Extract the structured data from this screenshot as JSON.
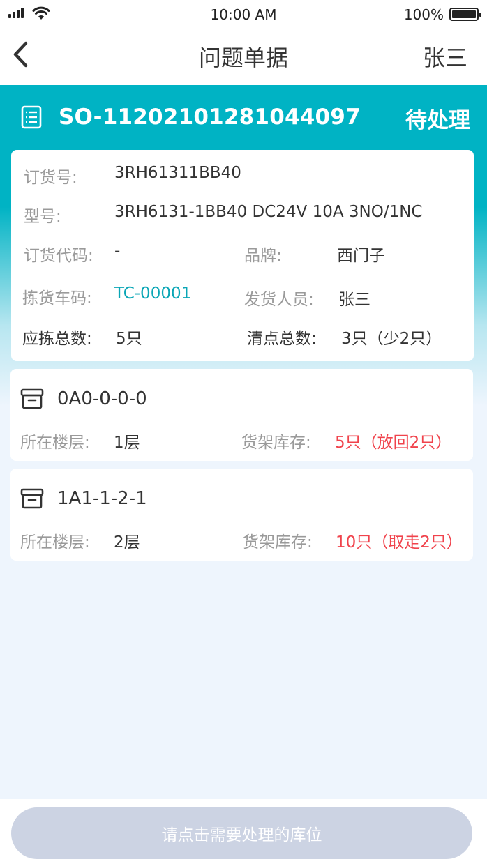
{
  "status_bar": {
    "time": "10:00 AM",
    "battery": "100%"
  },
  "nav": {
    "title": "问题单据",
    "user": "张三",
    "back_icon": "chevron-left-icon"
  },
  "order": {
    "number": "SO-11202101281044097",
    "status": "待处理",
    "icon": "document-list-icon"
  },
  "details": {
    "order_no_label": "订货号:",
    "order_no": "3RH61311BB40",
    "model_label": "型号:",
    "model": "3RH6131-1BB40 DC24V 10A 3NO/1NC",
    "order_code_label": "订货代码:",
    "order_code": "-",
    "brand_label": "品牌:",
    "brand": "西门子",
    "pick_cart_label": "拣货车码:",
    "pick_cart": "TC-00001",
    "shipper_label": "发货人员:",
    "shipper": "张三",
    "pick_total_label": "应拣总数:",
    "pick_total": "5只",
    "count_total_label": "清点总数:",
    "count_total": "3只（少2只）"
  },
  "locations": [
    {
      "code": "0A0-0-0-0",
      "floor_label": "所在楼层:",
      "floor": "1层",
      "stock_label": "货架库存:",
      "stock": "5只（放回2只）"
    },
    {
      "code": "1A1-1-2-1",
      "floor_label": "所在楼层:",
      "floor": "2层",
      "stock_label": "货架库存:",
      "stock": "10只（取走2只）"
    }
  ],
  "footer": {
    "button": "请点击需要处理的库位"
  },
  "colors": {
    "teal": "#00b3c4",
    "red": "#f0434c",
    "button_disabled": "#ccd3e3"
  }
}
